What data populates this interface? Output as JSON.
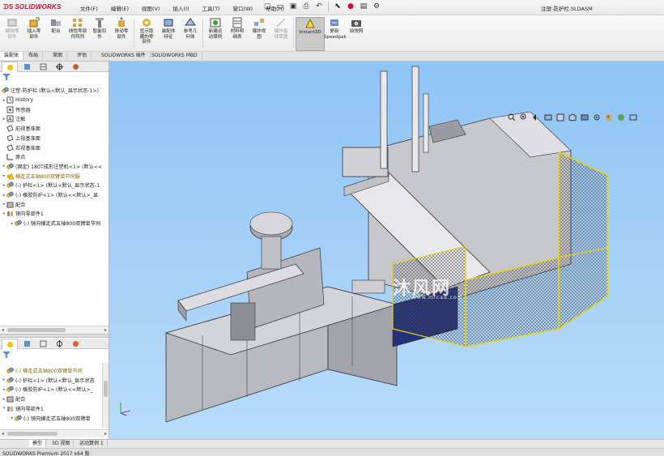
{
  "app": {
    "brand": "SOLIDWORKS",
    "title": "注塑-防护栏.SLDASM"
  },
  "menu": [
    "文件(F)",
    "编辑(E)",
    "视图(V)",
    "插入(I)",
    "工具(T)",
    "窗口(W)",
    "帮助(H)"
  ],
  "ribbon": [
    {
      "label": "编辑零\n部件",
      "icon": "edit-component-icon",
      "disabled": true
    },
    {
      "label": "插入零\n部件",
      "icon": "insert-component-icon",
      "disabled": false
    },
    {
      "label": "配合",
      "icon": "mate-icon",
      "disabled": false
    },
    {
      "label": "线性零部\n件阵列",
      "icon": "linear-pattern-icon",
      "disabled": false
    },
    {
      "label": "智能扣\n件",
      "icon": "smart-fastener-icon",
      "disabled": false
    },
    {
      "label": "移动零\n部件",
      "icon": "move-component-icon",
      "disabled": false
    },
    {
      "label": "显示隐\n藏的零\n部件",
      "icon": "show-hidden-icon",
      "disabled": false
    },
    {
      "label": "装配体\n特征",
      "icon": "assembly-feature-icon",
      "disabled": false
    },
    {
      "label": "参考几\n何体",
      "icon": "reference-geometry-icon",
      "disabled": false
    },
    {
      "label": "新建运\n动算例",
      "icon": "motion-study-icon",
      "disabled": false
    },
    {
      "label": "材料明\n细表",
      "icon": "bom-icon",
      "disabled": false
    },
    {
      "label": "爆炸视\n图",
      "icon": "explode-view-icon",
      "disabled": false
    },
    {
      "label": "爆炸直\n线草图",
      "icon": "explode-line-icon",
      "disabled": true
    },
    {
      "label": "Instant3D",
      "icon": "instant3d-icon",
      "disabled": false,
      "active": true
    },
    {
      "label": "更新\nSpeedpak",
      "icon": "speedpak-icon",
      "disabled": false
    },
    {
      "label": "拍快照",
      "icon": "snapshot-icon",
      "disabled": false
    }
  ],
  "command_tabs": [
    "装配体",
    "布局",
    "草图",
    "评估",
    "SOLIDWORKS 插件",
    "SOLIDWORKS MBD"
  ],
  "tree_top": {
    "root": "注塑-防护栏 (默认<默认_显示状态-1>)",
    "items": [
      {
        "label": "History",
        "icon": "history-icon",
        "indent": 1,
        "exp": "▸"
      },
      {
        "label": "传感器",
        "icon": "sensor-icon",
        "indent": 1,
        "exp": ""
      },
      {
        "label": "注解",
        "icon": "annotation-icon",
        "indent": 1,
        "exp": "▸"
      },
      {
        "label": "前视基准面",
        "icon": "plane-icon",
        "indent": 1,
        "exp": ""
      },
      {
        "label": "上视基准面",
        "icon": "plane-icon",
        "indent": 1,
        "exp": ""
      },
      {
        "label": "右视基准面",
        "icon": "plane-icon",
        "indent": 1,
        "exp": ""
      },
      {
        "label": "原点",
        "icon": "origin-icon",
        "indent": 1,
        "exp": ""
      },
      {
        "label": "(固定) 180T成形注塑机<1> (默认<<",
        "icon": "part-icon",
        "indent": 1,
        "exp": "▸"
      },
      {
        "label": "横走式五轴800双臂单节伺服",
        "icon": "warning-part-icon",
        "indent": 1,
        "exp": "▸",
        "warn": true
      },
      {
        "label": "(-) 护栏<1> (默认<默认_显示状态-1",
        "icon": "part-icon",
        "indent": 1,
        "exp": "▸"
      },
      {
        "label": "(-) 橡胶防护<1> (默认<<默认>_显",
        "icon": "part-icon",
        "indent": 1,
        "exp": "▸"
      },
      {
        "label": "配合",
        "icon": "mates-folder-icon",
        "indent": 1,
        "exp": "▸"
      },
      {
        "label": "镜向零部件1",
        "icon": "mirror-icon",
        "indent": 1,
        "exp": "▾"
      },
      {
        "label": "(-) 镜向横走式五轴800双臂单节伺",
        "icon": "part-icon",
        "indent": 2,
        "exp": "▸"
      }
    ]
  },
  "tree_bottom": {
    "items": [
      {
        "label": "(-) 横走式五轴800双臂单节伺",
        "icon": "part-icon",
        "indent": 1,
        "exp": "",
        "warn": true
      },
      {
        "label": "(-) 护栏<1> (默认<默认_显示状态",
        "icon": "part-icon",
        "indent": 1,
        "exp": "▸"
      },
      {
        "label": "(-) 橡胶防护<1> (默认<<默认>_",
        "icon": "part-icon",
        "indent": 1,
        "exp": "▸"
      },
      {
        "label": "配合",
        "icon": "mates-folder-icon",
        "indent": 1,
        "exp": "▸"
      },
      {
        "label": "镜向零部件1",
        "icon": "mirror-icon",
        "indent": 1,
        "exp": "▾"
      },
      {
        "label": "(-) 镜向横走式五轴800双臂单",
        "icon": "part-icon",
        "indent": 2,
        "exp": "▸"
      }
    ]
  },
  "bottom_tabs": [
    "模型",
    "3D 视图",
    "运动算例 1"
  ],
  "status": "SOLIDWORKS Premium 2017 x64 版",
  "watermark": {
    "text": "沐风网",
    "url": "www.mfcad.com"
  },
  "colors": {
    "brand": "#c8102e",
    "viewport_top": "#8fc4f5",
    "guard": "#e6d21a",
    "machine": "#c9c9cf"
  }
}
